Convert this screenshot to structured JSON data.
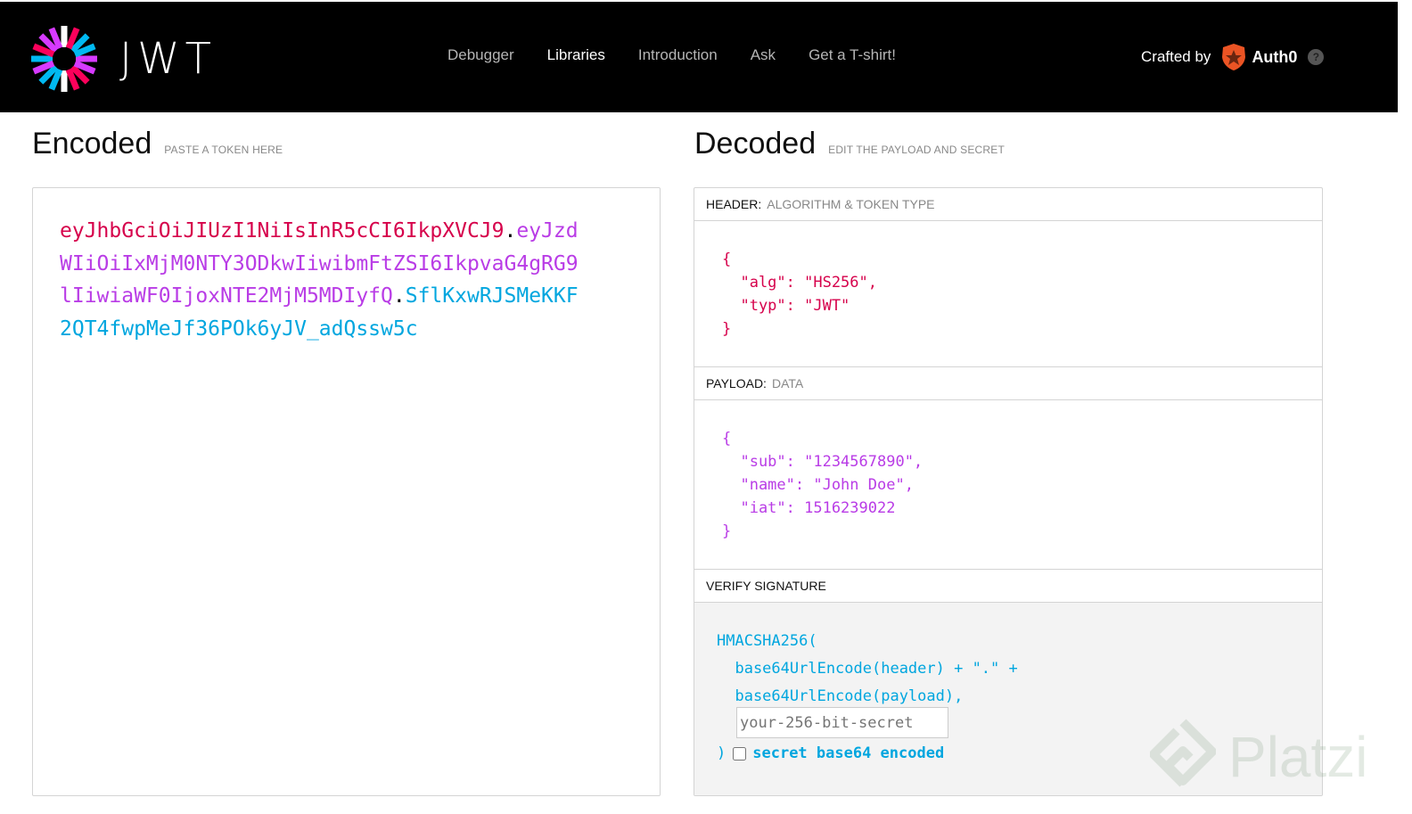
{
  "brand": {
    "wordmark": "JWT",
    "logo_icon": "jwt-starburst-icon",
    "colors": [
      "#fb015b",
      "#d63aff",
      "#00b9f1",
      "#ffffff"
    ]
  },
  "nav": {
    "items": [
      {
        "label": "Debugger",
        "active": false
      },
      {
        "label": "Libraries",
        "active": true
      },
      {
        "label": "Introduction",
        "active": false
      },
      {
        "label": "Ask",
        "active": false
      },
      {
        "label": "Get a T-shirt!",
        "active": false
      }
    ],
    "crafted_by": "Crafted by",
    "partner_name": "Auth0",
    "help": "?"
  },
  "encoded": {
    "title": "Encoded",
    "subtitle": "PASTE A TOKEN HERE",
    "token_header": "eyJhbGciOiJIUzI1NiIsInR5cCI6IkpXVCJ9",
    "token_payload": "eyJzdWIiOiIxMjM0NTY3ODkwIiwibmFtZSI6IkpvaG4gRG9lIiwiaWF0IjoxNTE2MjM5MDIyfQ",
    "token_signature": "SflKxwRJSMeKKF2QT4fwpMeJf36POk6yJV_adQssw5c",
    "dot": "."
  },
  "decoded": {
    "title": "Decoded",
    "subtitle": "EDIT THE PAYLOAD AND SECRET",
    "header": {
      "label": "HEADER:",
      "hint": "ALGORITHM & TOKEN TYPE",
      "json": "{\n  \"alg\": \"HS256\",\n  \"typ\": \"JWT\"\n}"
    },
    "payload": {
      "label": "PAYLOAD:",
      "hint": "DATA",
      "json": "{\n  \"sub\": \"1234567890\",\n  \"name\": \"John Doe\",\n  \"iat\": 1516239022\n}"
    },
    "verify": {
      "label": "VERIFY SIGNATURE",
      "line1": "HMACSHA256(",
      "line2": "  base64UrlEncode(header) + \".\" +",
      "line3": "  base64UrlEncode(payload),",
      "secret_placeholder": "your-256-bit-secret",
      "close_paren": ")",
      "checkbox_label": "secret base64 encoded",
      "checkbox_checked": false
    }
  },
  "watermark": {
    "text": "Platzi"
  }
}
